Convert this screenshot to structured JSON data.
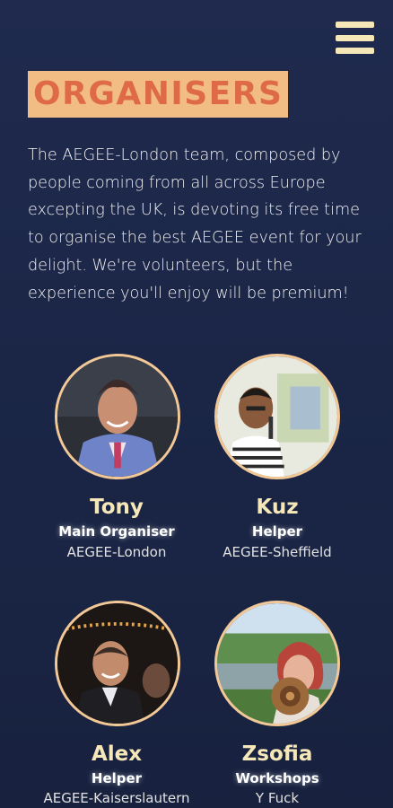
{
  "header": {
    "menu_icon": "hamburger-menu-icon"
  },
  "section": {
    "title": "ORGANISERS",
    "intro": "The AEGEE-London team, composed by people coming from all across Europe excepting the UK, is devoting its free time to organise the best AEGEE event for your delight. We're volunteers, but the experience you'll enjoy will be premium!"
  },
  "organisers": [
    {
      "name": "Tony",
      "role": "Main Organiser",
      "group": "AEGEE-London"
    },
    {
      "name": "Kuz",
      "role": "Helper",
      "group": "AEGEE-Sheffield"
    },
    {
      "name": "Alex",
      "role": "Helper",
      "group": "AEGEE-Kaiserslautern"
    },
    {
      "name": "Zsofia",
      "role": "Workshops",
      "group": "Y Fuck"
    }
  ],
  "colors": {
    "background": "#1d2849",
    "title_bg": "#f2bd84",
    "title_text": "#de6a48",
    "accent_text": "#f5e7b7",
    "avatar_border": "#f2c896"
  }
}
